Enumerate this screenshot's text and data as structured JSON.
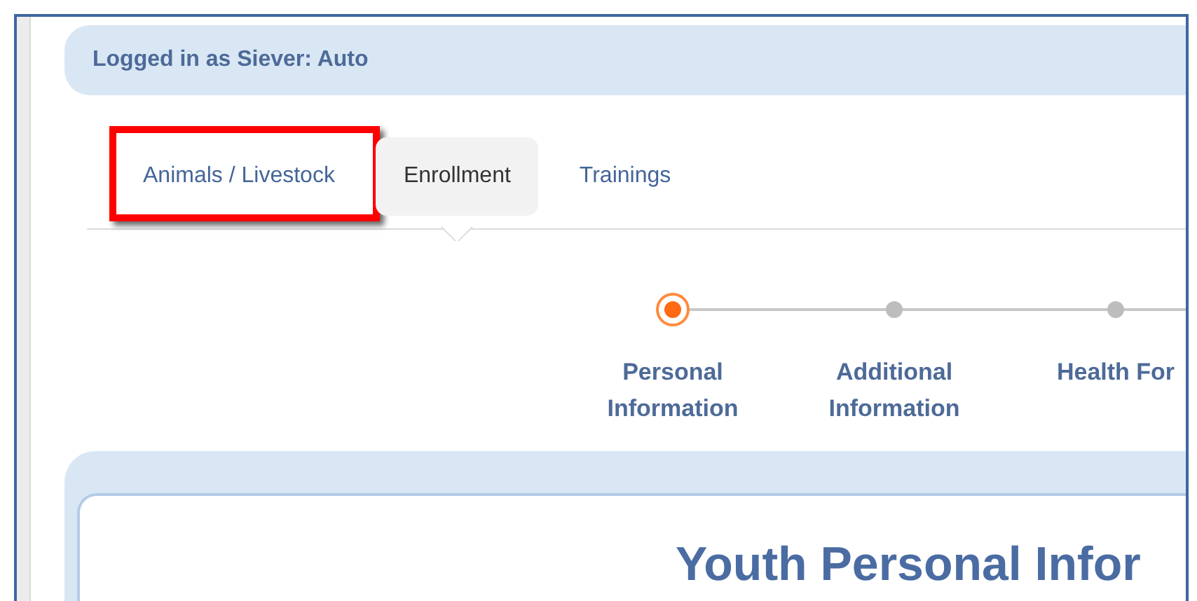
{
  "banner": {
    "text": "Logged in as Siever: Auto"
  },
  "tabs": [
    {
      "label": "Animals / Livestock",
      "selected": false,
      "highlighted": true
    },
    {
      "label": "Enrollment",
      "selected": true,
      "highlighted": false
    },
    {
      "label": "Trainings",
      "selected": false,
      "highlighted": false
    }
  ],
  "steps": [
    {
      "label": "Personal Information",
      "current": true
    },
    {
      "label": "Additional Information",
      "current": false
    },
    {
      "label": "Health For",
      "current": false
    }
  ],
  "panel": {
    "title": "Youth Personal Infor"
  }
}
